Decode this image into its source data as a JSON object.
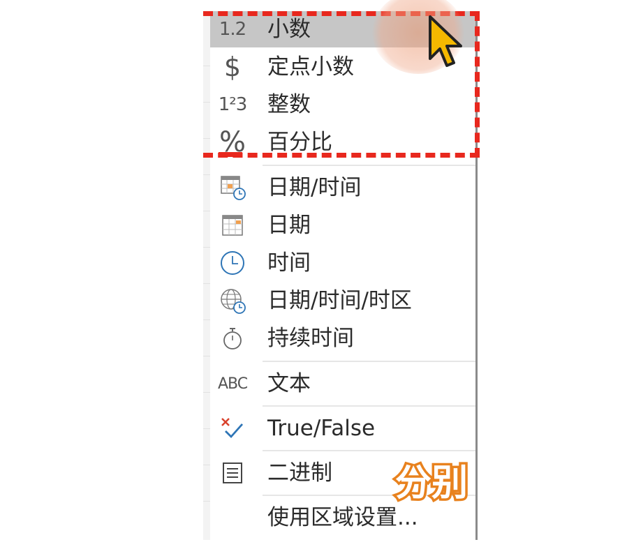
{
  "menu": {
    "items": [
      {
        "label": "小数",
        "icon_text": "1.2",
        "icon": "decimal-icon"
      },
      {
        "label": "定点小数",
        "icon_text": "$",
        "icon": "dollar-icon"
      },
      {
        "label": "整数",
        "icon_text": "1²3",
        "icon": "whole-number-icon"
      },
      {
        "label": "百分比",
        "icon_text": "%",
        "icon": "percent-icon"
      },
      {
        "label": "日期/时间",
        "icon": "datetime-icon"
      },
      {
        "label": "日期",
        "icon": "calendar-icon"
      },
      {
        "label": "时间",
        "icon": "clock-icon"
      },
      {
        "label": "日期/时间/时区",
        "icon": "timezone-icon"
      },
      {
        "label": "持续时间",
        "icon": "stopwatch-icon"
      },
      {
        "label": "文本",
        "icon_text": "ABC",
        "icon": "text-icon"
      },
      {
        "label": "True/False",
        "icon": "true-false-icon"
      },
      {
        "label": "二进制",
        "icon": "binary-icon"
      },
      {
        "label": "使用区域设置..."
      }
    ],
    "highlighted_index": 0
  },
  "caption": "分别",
  "colors": {
    "highlight": "#c6c6c6",
    "dash": "#e8281e",
    "caption_stroke": "#e8821f",
    "cursor": "#f5b800"
  }
}
